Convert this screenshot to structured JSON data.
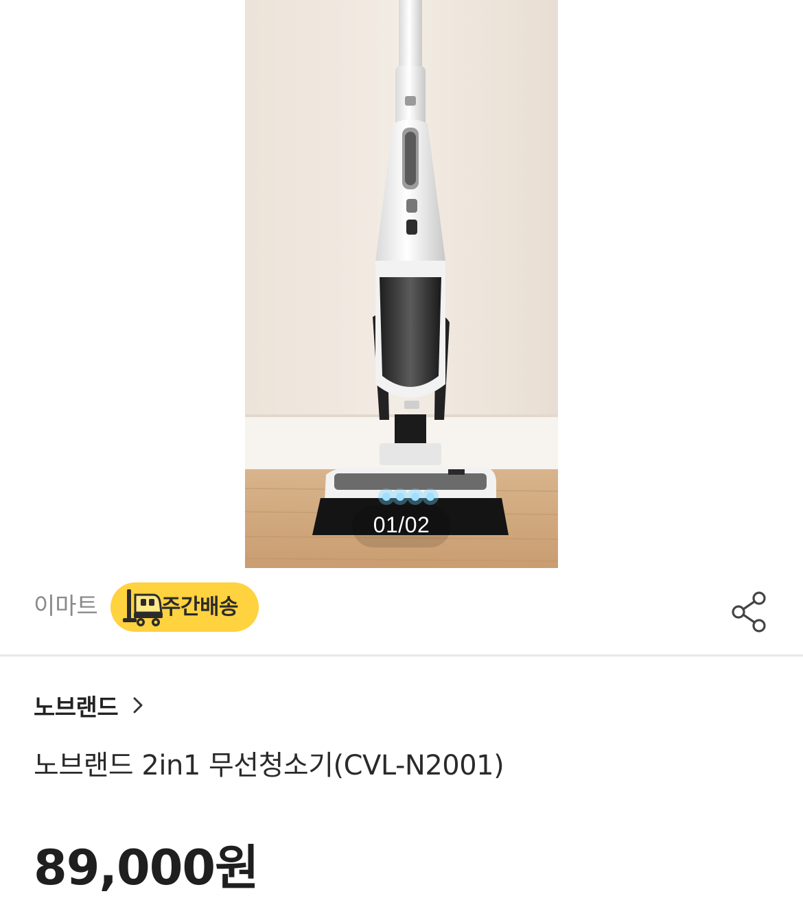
{
  "gallery": {
    "counter": "01/02"
  },
  "seller": {
    "name": "이마트",
    "delivery_badge": "주간배송",
    "badge_color": "#FFD23F"
  },
  "icons": {
    "delivery": "truck-icon",
    "share": "share-icon",
    "brand_chevron": "chevron-right-icon"
  },
  "product": {
    "brand": "노브랜드",
    "title": "노브랜드 2in1 무선청소기(CVL-N2001)",
    "price": "89,000원"
  }
}
